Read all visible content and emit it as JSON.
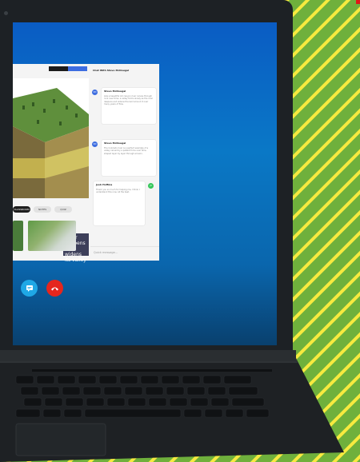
{
  "app": {
    "header_tabs": [
      "",
      ""
    ],
    "chat_title": "Chat With Steve McDougal",
    "caption_lines": [
      "River deepens",
      "and widens",
      "its valley"
    ],
    "tabs": [
      {
        "label": "CLASSROOM",
        "active": true
      },
      {
        "label": "NOTES",
        "active": false
      },
      {
        "label": "QUIZ",
        "active": false
      }
    ],
    "messages": [
      {
        "avatar": "SM",
        "name": "Steve McDougal",
        "text": "Like a beautiful old canyon river carves through rock over time, a valley forms slowly as the river deepens and widens the land around it over many years of flow."
      },
      {
        "avatar": "SM",
        "name": "Steve McDougal",
        "text": "The Colorado river is a perfect example of a valley carved by a patient force over time, shaped layer by layer through erosion."
      },
      {
        "avatar": "JH",
        "name": "Josh Hoffma",
        "text": "Thank you so much for helping me, I think I understand this now. All the best."
      }
    ],
    "composer_placeholder": "Quick message..."
  },
  "colors": {
    "brand_blue": "#3d6de0",
    "chat_button": "#1fa8e6",
    "hangup_button": "#e5261e",
    "background_green": "#6fb03c",
    "stripe_yellow": "#f7ea3f",
    "avatar_green": "#34c759"
  },
  "icons": {
    "chat": "chat-bubble-icon",
    "hangup": "phone-hangup-icon"
  }
}
